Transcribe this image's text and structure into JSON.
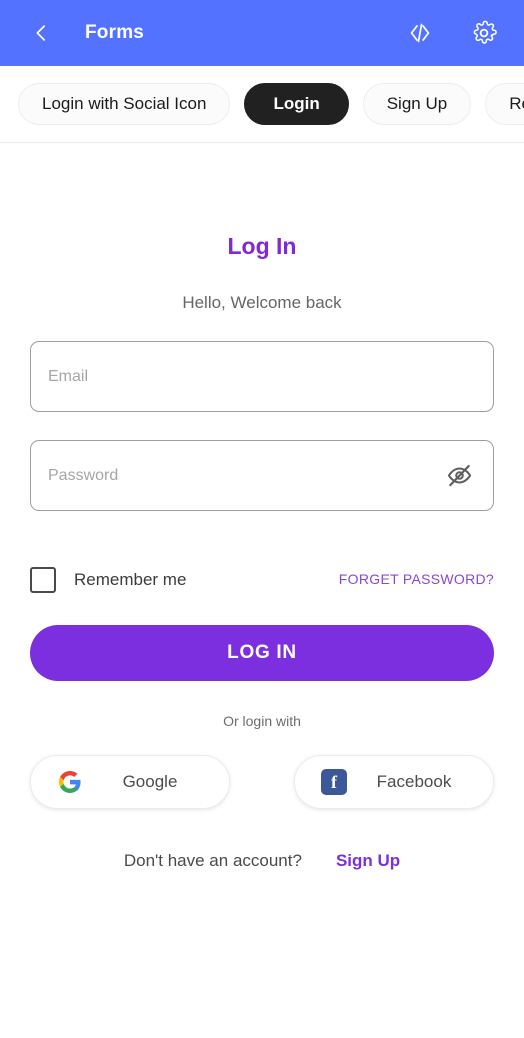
{
  "appbar": {
    "title": "Forms",
    "back_icon": "chevron-left-icon",
    "code_icon": "code-brackets-icon",
    "settings_icon": "gear-icon",
    "background": "#5272FF"
  },
  "tabs": [
    {
      "label": "Login with Social Icon",
      "active": false
    },
    {
      "label": "Login",
      "active": true
    },
    {
      "label": "Sign Up",
      "active": false
    },
    {
      "label": "Res",
      "active": false
    }
  ],
  "form": {
    "headline": "Log In",
    "headline_color": "#8128D8",
    "subhead": "Hello, Welcome back",
    "email": {
      "value": "",
      "placeholder": "Email"
    },
    "password": {
      "value": "",
      "placeholder": "Password",
      "toggle_icon": "eye-off-icon"
    },
    "remember_label": "Remember me",
    "remember_checked": false,
    "forgot_label": "FORGET PASSWORD?",
    "forgot_color": "#8B46D6",
    "submit_label": "LOG IN",
    "submit_color": "#7B2FDE"
  },
  "social": {
    "divider_text": "Or login with",
    "buttons": [
      {
        "label": "Google",
        "icon": "google-icon"
      },
      {
        "label": "Facebook",
        "icon": "facebook-icon"
      }
    ]
  },
  "footer": {
    "question": "Don't have an account?",
    "link_label": "Sign Up",
    "link_color": "#7B2FDE"
  }
}
